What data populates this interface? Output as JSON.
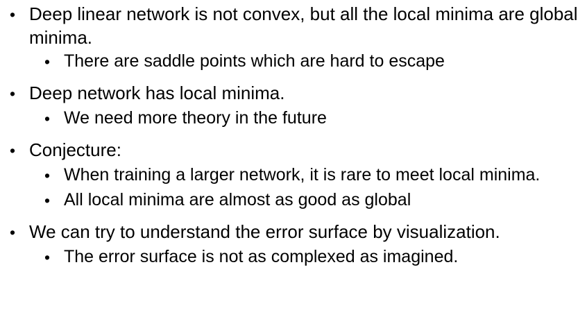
{
  "slide": {
    "bullets": [
      {
        "text": "Deep linear network is not convex, but all the local minima are global minima.",
        "subs": [
          "There are saddle points which are hard to escape"
        ]
      },
      {
        "text": "Deep network has local minima.",
        "subs": [
          "We need more theory in the future"
        ]
      },
      {
        "text": "Conjecture:",
        "subs": [
          "When training a larger network, it is rare to meet local minima.",
          "All local minima are almost as good as global"
        ]
      },
      {
        "text": "We can try to understand the error surface by visualization.",
        "subs": [
          "The error surface is not as complexed as imagined."
        ]
      }
    ]
  }
}
